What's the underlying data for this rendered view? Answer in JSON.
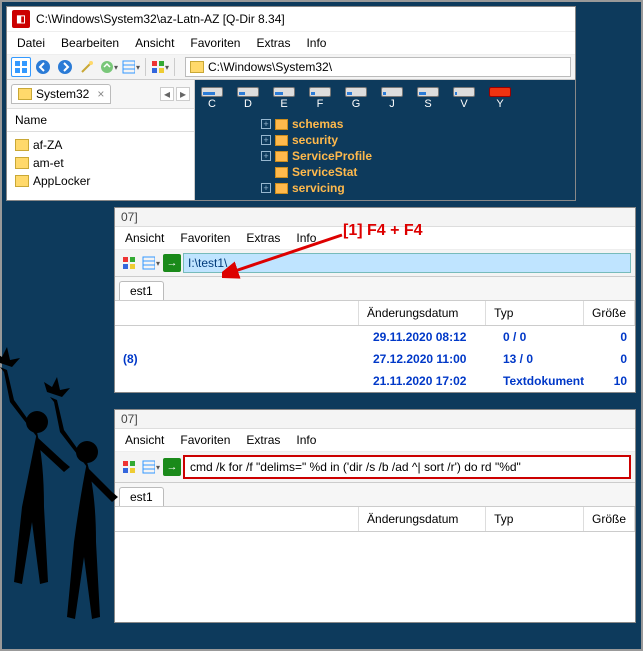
{
  "topWindow": {
    "title": "C:\\Windows\\System32\\az-Latn-AZ  [Q-Dir 8.34]",
    "menu": {
      "file": "Datei",
      "edit": "Bearbeiten",
      "view": "Ansicht",
      "fav": "Favoriten",
      "extras": "Extras",
      "info": "Info"
    },
    "addressPath": "C:\\Windows\\System32\\",
    "leftPane": {
      "tab": "System32",
      "header": "Name",
      "items": [
        "af-ZA",
        "am-et",
        "AppLocker"
      ]
    },
    "drives": [
      "C",
      "D",
      "E",
      "F",
      "G",
      "J",
      "S",
      "V",
      "Y"
    ],
    "rightTree": [
      "schemas",
      "security",
      "ServiceProfile",
      "ServiceStat",
      "servicing"
    ]
  },
  "midWindow": {
    "headerNum": "07]",
    "menu": {
      "view": "Ansicht",
      "fav": "Favoriten",
      "extras": "Extras",
      "info": "Info"
    },
    "addressPath": "I:\\test1\\",
    "tab": "est1",
    "columns": {
      "date": "Änderungsdatum",
      "type": "Typ",
      "size": "Größe"
    },
    "rows": [
      {
        "name": "",
        "date": "29.11.2020 08:12",
        "type": "0 / 0",
        "size": "0"
      },
      {
        "name": "(8)",
        "date": "27.12.2020 11:00",
        "type": "13 / 0",
        "size": "0"
      },
      {
        "name": "",
        "date": "21.11.2020 17:02",
        "type": "Textdokument",
        "size": "10"
      }
    ]
  },
  "botWindow": {
    "headerNum": "07]",
    "menu": {
      "view": "Ansicht",
      "fav": "Favoriten",
      "extras": "Extras",
      "info": "Info"
    },
    "command": "cmd /k for /f \"delims=\" %d in ('dir /s /b /ad ^| sort /r') do rd \"%d\"",
    "tab": "est1",
    "columns": {
      "date": "Änderungsdatum",
      "type": "Typ",
      "size": "Größe"
    }
  },
  "annotation": "[1] F4 + F4"
}
